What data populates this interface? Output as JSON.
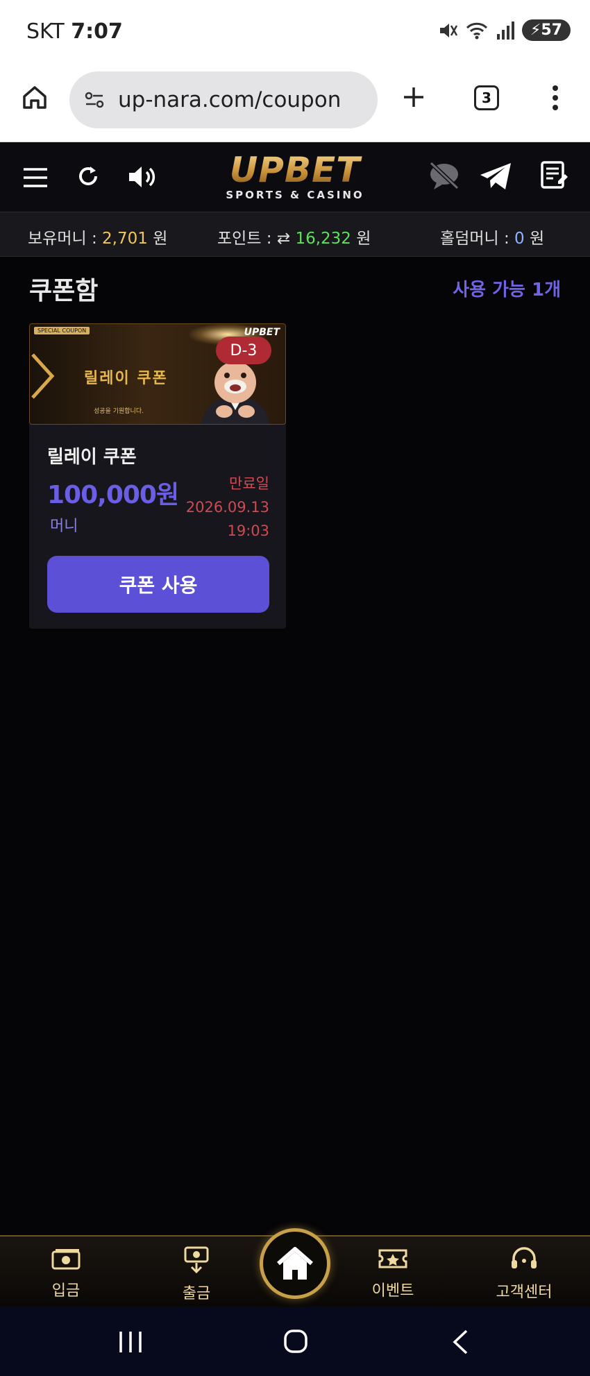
{
  "status_bar": {
    "carrier": "SKT",
    "time": "7:07",
    "battery": "57"
  },
  "browser": {
    "url": "up-nara.com/coupon",
    "tab_count": "3"
  },
  "site": {
    "logo_main": "UPBET",
    "logo_sub": "SPORTS & CASINO"
  },
  "balance": {
    "money_label": "보유머니 :",
    "money_value": "2,701",
    "money_unit": "원",
    "point_label": "포인트 :",
    "point_value": "16,232",
    "point_unit": "원",
    "holdem_label": "홀덤머니 :",
    "holdem_value": "0",
    "holdem_unit": "원"
  },
  "main": {
    "title": "쿠폰함",
    "available": "사용 가능 1개",
    "coupons": [
      {
        "banner_tag": "SPECIAL COUPON",
        "banner_title": "릴레이 쿠폰",
        "banner_sub": "성공을 기원합니다.",
        "banner_logo": "UPBET",
        "days_left": "D-3",
        "name": "릴레이 쿠폰",
        "amount": "100,000원",
        "type": "머니",
        "expiry_label": "만료일",
        "expiry_date": "2026.09.13",
        "expiry_time": "19:03",
        "button": "쿠폰 사용"
      }
    ]
  },
  "bottom_nav": {
    "deposit": "입금",
    "withdraw": "출금",
    "event": "이벤트",
    "support": "고객센터"
  },
  "colors": {
    "accent": "#5b50d6",
    "gold": "#c9a04a",
    "expiry": "#d04a52"
  }
}
